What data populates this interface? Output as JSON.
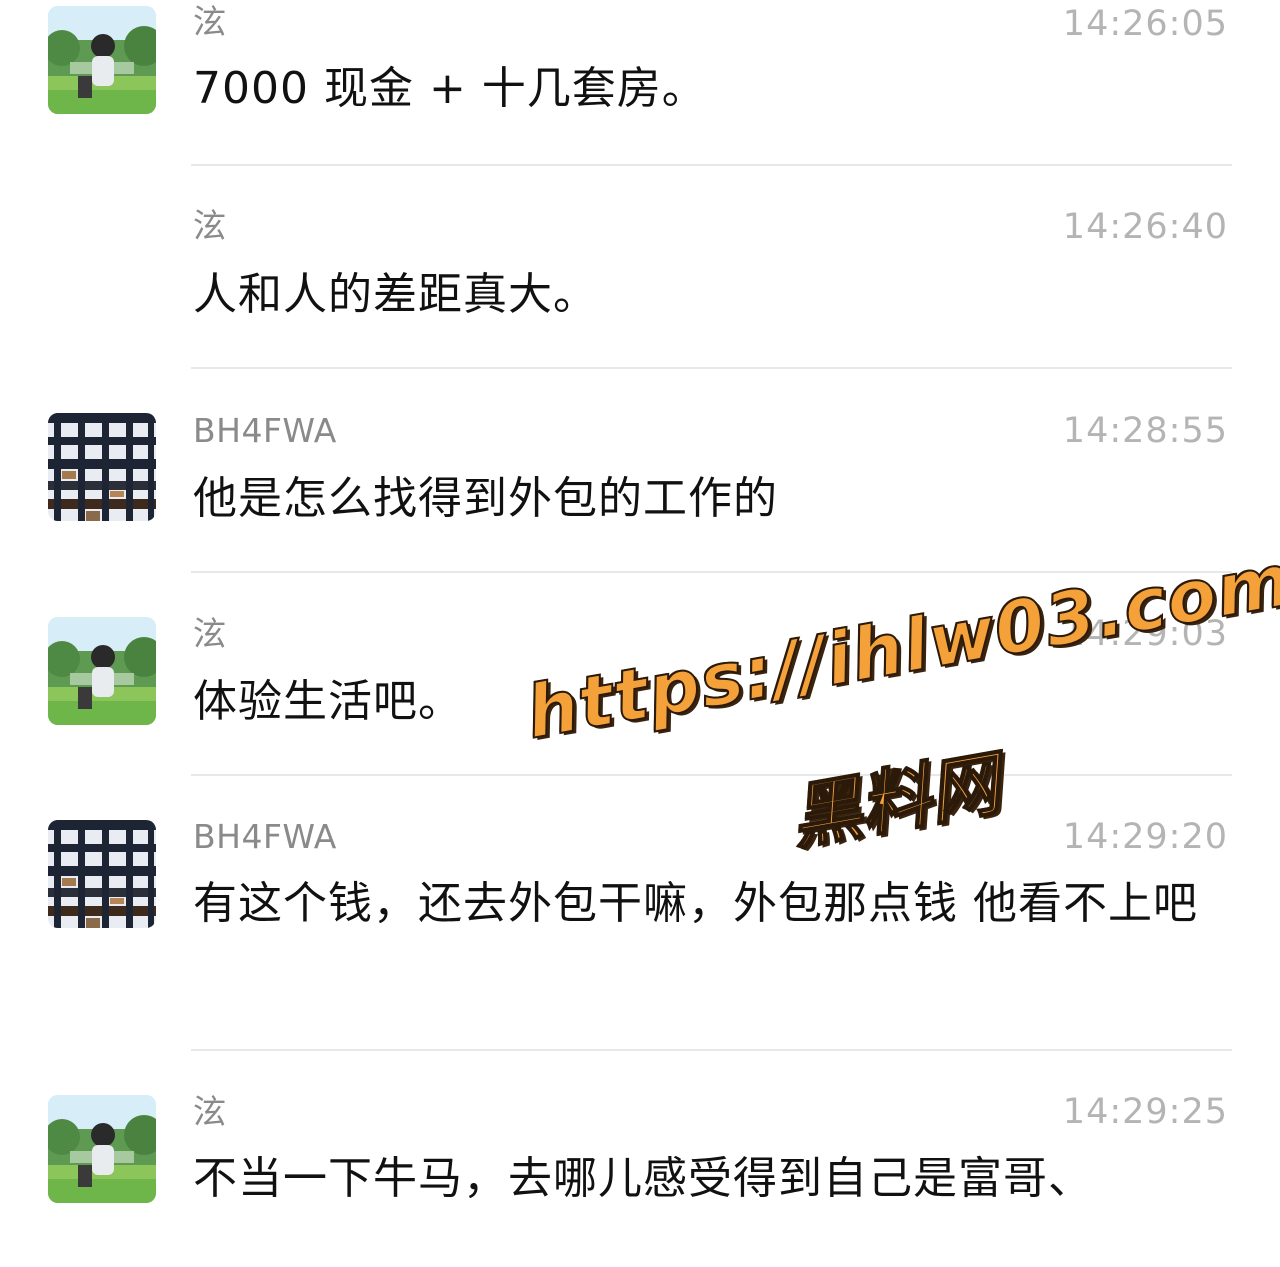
{
  "messages": [
    {
      "sender": "泫",
      "time": "14:26:05",
      "text": "7000 现金 + 十几套房。",
      "avatar": "anime-boy-avatar",
      "show_avatar": true
    },
    {
      "sender": "泫",
      "time": "14:26:40",
      "text": "人和人的差距真大。",
      "avatar": "anime-boy-avatar",
      "show_avatar": false
    },
    {
      "sender": "BH4FWA",
      "time": "14:28:55",
      "text": "他是怎么找得到外包的工作的",
      "avatar": "building-grid-avatar",
      "show_avatar": true
    },
    {
      "sender": "泫",
      "time": "14:29:03",
      "text": "体验生活吧。",
      "avatar": "anime-boy-avatar",
      "show_avatar": true
    },
    {
      "sender": "BH4FWA",
      "time": "14:29:20",
      "text": "有这个钱，还去外包干嘛，外包那点钱 他看不上吧",
      "avatar": "building-grid-avatar",
      "show_avatar": true
    },
    {
      "sender": "泫",
      "time": "14:29:25",
      "text": "不当一下牛马，去哪儿感受得到自己是富哥、",
      "avatar": "anime-boy-avatar",
      "show_avatar": true
    }
  ],
  "watermark": {
    "url": "https://ihlw03.com",
    "name": "黑料网",
    "color": "#f5a13a"
  }
}
